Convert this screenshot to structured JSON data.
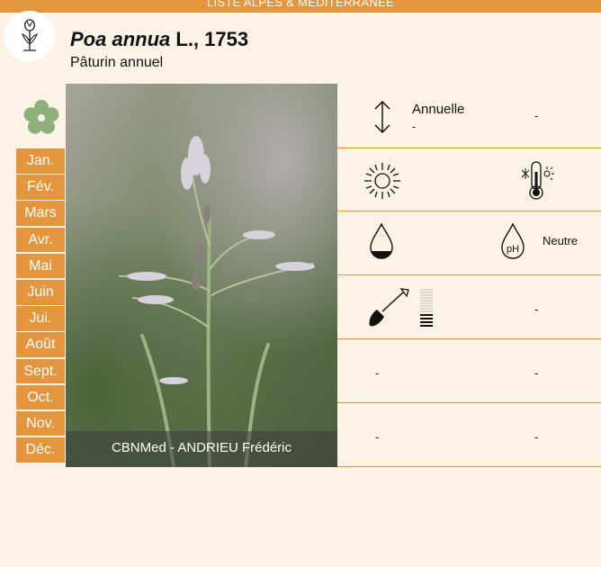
{
  "header": {
    "banner": "LISTE ALPES & MÉDITERRANÉE",
    "genus_species": "Poa annua",
    "authority": "L., 1753",
    "common_name": "Pâturin annuel"
  },
  "months": [
    "Jan.",
    "Fév.",
    "Mars",
    "Avr.",
    "Mai",
    "Juin",
    "Jui.",
    "Août",
    "Sept.",
    "Oct.",
    "Nov.",
    "Déc."
  ],
  "photo": {
    "credit": "CBNMed - ANDRIEU Frédéric"
  },
  "traits": {
    "life_form": "Annuelle",
    "life_form_sub": "-",
    "life_form_extra": "-",
    "ph_value": "Neutre",
    "soil_value": "-",
    "row5_left": "-",
    "row5_right": "-",
    "row6_left": "-",
    "row6_right": "-"
  },
  "colors": {
    "accent": "#e4963e",
    "background": "#fcf3e6",
    "flower": "#8fb07a"
  },
  "icons": [
    "tulip-logo-icon",
    "flower-icon",
    "height-arrow-icon",
    "sun-icon",
    "thermometer-icon",
    "water-drop-icon",
    "ph-drop-icon",
    "shovel-icon",
    "soil-scale-icon"
  ]
}
